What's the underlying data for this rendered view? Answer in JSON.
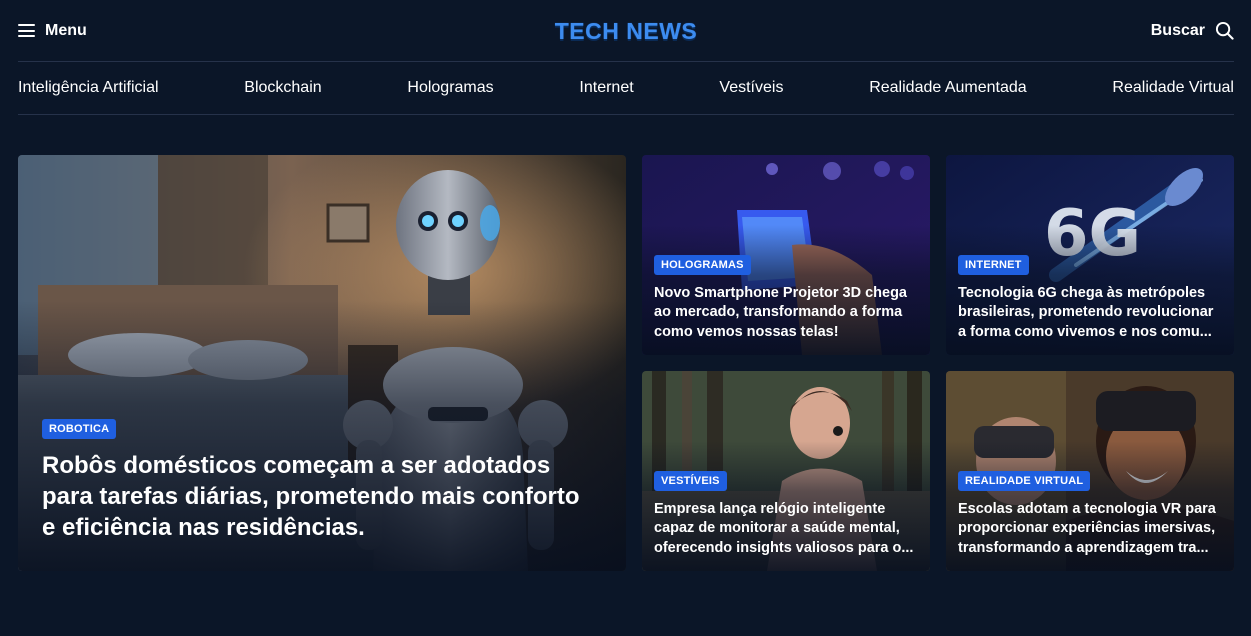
{
  "header": {
    "menu_label": "Menu",
    "logo": "TECH NEWS",
    "search_label": "Buscar",
    "menu_icon": "hamburger-icon",
    "search_icon": "search-icon"
  },
  "categories": [
    "Inteligência Artificial",
    "Blockchain",
    "Hologramas",
    "Internet",
    "Vestíveis",
    "Realidade Aumentada",
    "Realidade Virtual"
  ],
  "colors": {
    "background": "#0b1628",
    "logo": "#3d8cf0",
    "badge": "#1f5fe0"
  },
  "featured": {
    "badge": "ROBOTICA",
    "title": "Robôs domésticos começam a ser adotados para tarefas diárias, prometendo mais conforto e eficiência nas residências."
  },
  "articles": [
    {
      "badge": "HOLOGRAMAS",
      "title": "Novo Smartphone Projetor 3D chega ao mercado, transformando a forma como vemos nossas telas!"
    },
    {
      "badge": "INTERNET",
      "title": "Tecnologia 6G chega às metrópoles brasileiras, prometendo revolucionar a forma como vivemos e nos comu..."
    },
    {
      "badge": "VESTÍVEIS",
      "title": "Empresa lança relógio inteligente capaz de monitorar a saúde mental, oferecendo insights valiosos para o..."
    },
    {
      "badge": "REALIDADE VIRTUAL",
      "title": "Escolas adotam a tecnologia VR para proporcionar experiências imersivas, transformando a aprendizagem tra..."
    }
  ]
}
